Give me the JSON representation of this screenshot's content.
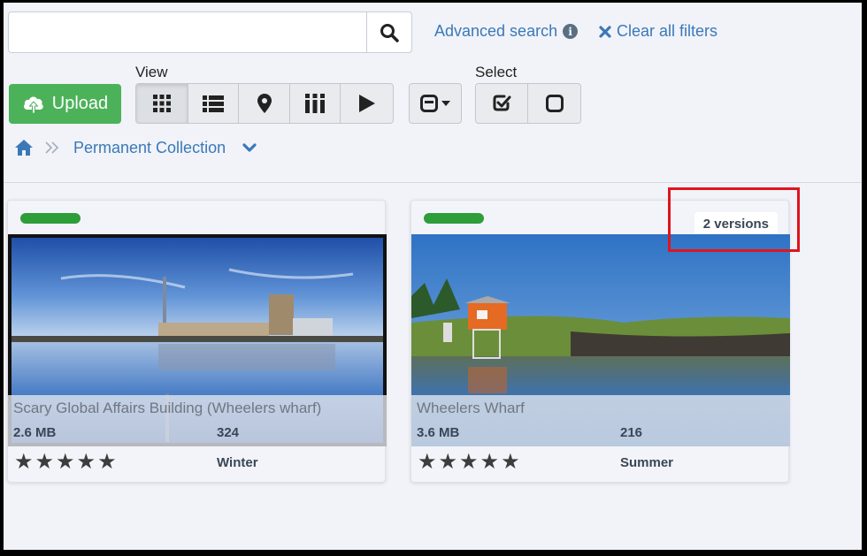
{
  "search": {
    "value": "",
    "placeholder": ""
  },
  "links": {
    "advanced_search": "Advanced search",
    "clear_filters": "Clear all filters"
  },
  "toolbar": {
    "upload_label": "Upload",
    "view_label": "View",
    "select_label": "Select",
    "view_buttons": [
      "grid-view-icon",
      "list-view-icon",
      "map-view-icon",
      "columns-view-icon",
      "slideshow-icon"
    ],
    "active_view": "grid-view-icon"
  },
  "breadcrumb": {
    "collection": "Permanent Collection"
  },
  "colors": {
    "accent_link": "#3a79b8",
    "upload_green": "#4cb25a",
    "status_green": "#2e9d3a",
    "highlight_red": "#e0141e"
  },
  "cards": [
    {
      "title": "Scary Global Affairs Building (Wheelers wharf)",
      "size": "2.6 MB",
      "count": "324",
      "season": "Winter",
      "rating": 5,
      "versions": ""
    },
    {
      "title": "Wheelers Wharf",
      "size": "3.6 MB",
      "count": "216",
      "season": "Summer",
      "rating": 5,
      "versions": "2 versions"
    }
  ]
}
